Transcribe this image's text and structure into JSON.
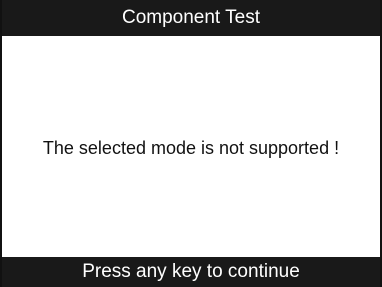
{
  "header": {
    "title": "Component Test"
  },
  "main": {
    "message": "The selected mode is not supported !"
  },
  "footer": {
    "prompt": "Press any key to continue"
  },
  "colors": {
    "bar_background": "#191919",
    "bar_text": "#ffffff",
    "screen_background": "#ffffff",
    "message_text": "#111111"
  }
}
